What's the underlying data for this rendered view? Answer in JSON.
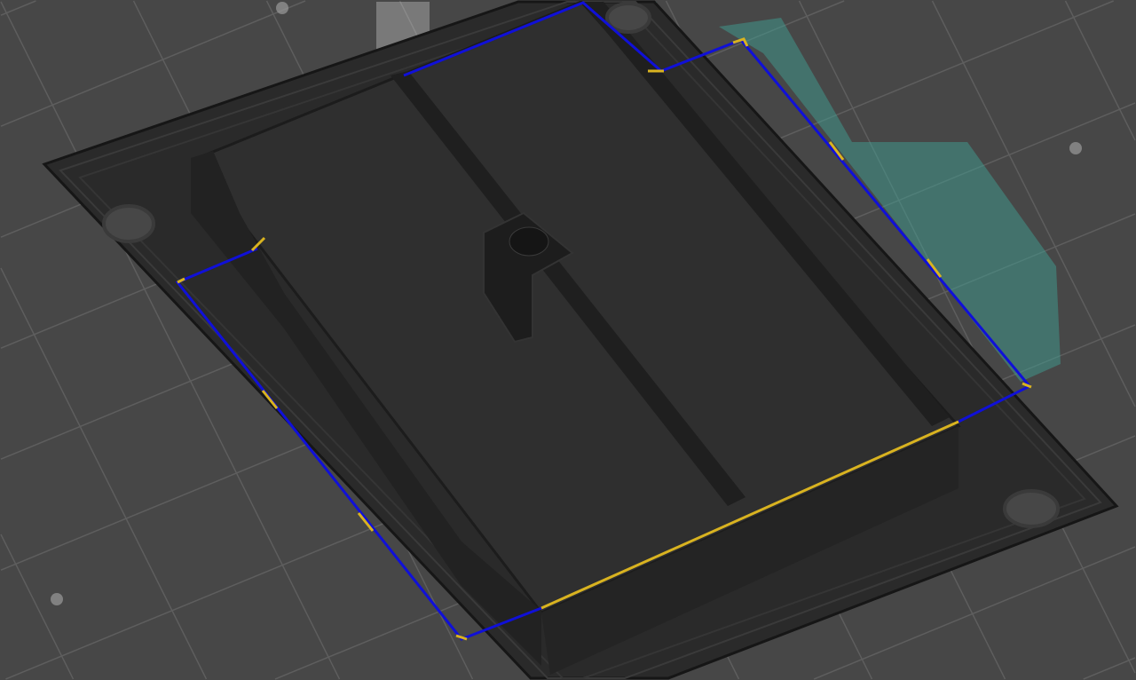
{
  "scene": {
    "background_color": "#474747",
    "grid_color": "#5e5e5e",
    "model_color": "#262626",
    "model_edge_color": "#1a1a1a",
    "ghost_object_color": "#3fa79a",
    "toolpath_travel_color": "#1010d8",
    "toolpath_retract_color": "#d9b320"
  }
}
